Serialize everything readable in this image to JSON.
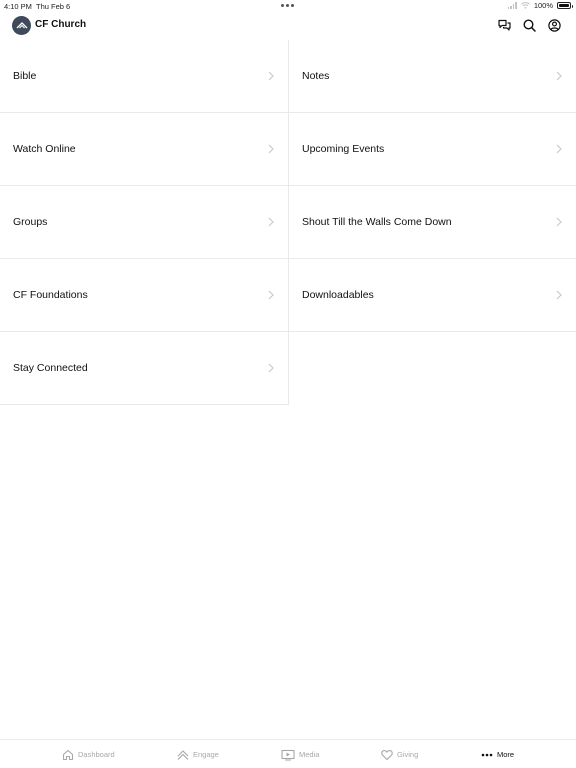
{
  "status_bar": {
    "time": "4:10 PM",
    "date": "Thu Feb 6",
    "battery": "100%",
    "battery_level": 1.0
  },
  "header": {
    "app_title": "CF Church",
    "logo_icon": "church-logo-icon",
    "actions": [
      {
        "icon": "chat-icon"
      },
      {
        "icon": "search-icon"
      },
      {
        "icon": "account-icon"
      }
    ]
  },
  "menu": {
    "items": [
      {
        "label": "Bible"
      },
      {
        "label": "Notes"
      },
      {
        "label": "Watch Online"
      },
      {
        "label": "Upcoming Events"
      },
      {
        "label": "Groups"
      },
      {
        "label": "Shout Till the Walls Come Down"
      },
      {
        "label": "CF Foundations"
      },
      {
        "label": "Downloadables"
      },
      {
        "label": "Stay Connected"
      }
    ]
  },
  "tabbar": {
    "active": "More",
    "tabs": [
      {
        "label": "Dashboard",
        "icon": "home-icon"
      },
      {
        "label": "Engage",
        "icon": "engage-icon"
      },
      {
        "label": "Media",
        "icon": "media-icon"
      },
      {
        "label": "Giving",
        "icon": "heart-icon"
      },
      {
        "label": "More",
        "icon": "more-icon"
      }
    ]
  },
  "colors": {
    "logo_bg": "#3e4a5c",
    "divider": "#e9e9e9",
    "inactive_tab": "#a8a8a8",
    "active_tab": "#111111"
  }
}
